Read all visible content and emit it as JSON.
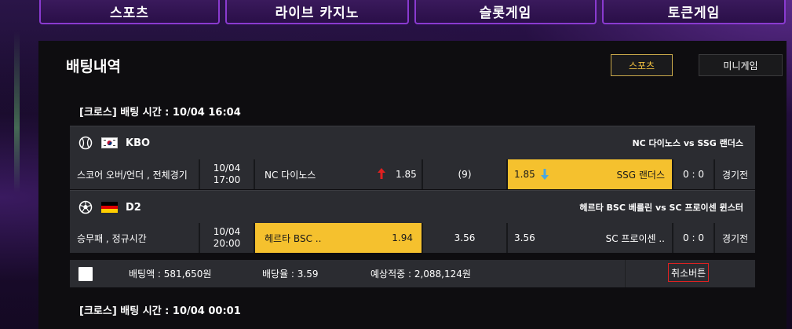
{
  "topnav": {
    "items": [
      "스포츠",
      "라이브 카지노",
      "슬롯게임",
      "토큰게임"
    ]
  },
  "panel": {
    "title": "배팅내역",
    "tabs": {
      "sports": "스포츠",
      "mini": "미니게임"
    }
  },
  "bets": [
    {
      "header": "[크로스] 배팅 시간 : 10/04 16:04",
      "matches": [
        {
          "sport_icon": "baseball-icon",
          "flag": "south-korea",
          "league": "KBO",
          "title": "NC 다이노스  vs  SSG 랜더스",
          "market": "스코어 오버/언더 , 전체경기",
          "date": "10/04",
          "time": "17:00",
          "home": "NC 다이노스",
          "home_odds": "1.85",
          "home_arrow": "up",
          "mid": "(9)",
          "away_odds": "1.85",
          "away_arrow": "down",
          "away": "SSG 랜더스",
          "selected": "away",
          "score": "0 : 0",
          "status": "경기전"
        },
        {
          "sport_icon": "soccer-ball-icon",
          "flag": "germany",
          "league": "D2",
          "title": "헤르타 BSC 베를린  vs  SC 프로이센 뮌스터",
          "market": "승무패 , 정규시간",
          "date": "10/04",
          "time": "20:00",
          "home": "헤르타 BSC ..",
          "home_odds": "1.94",
          "mid": "3.56",
          "away_odds": "3.56",
          "away": "SC 프로이센 ..",
          "selected": "home",
          "score": "0 : 0",
          "status": "경기전"
        }
      ],
      "summary": {
        "bet_amount": "배팅액 : 581,650원",
        "odds": "배당율 : 3.59",
        "expected": "예상적중 : 2,088,124원",
        "cancel": "취소버튼"
      }
    },
    {
      "header": "[크로스] 배팅 시간 : 10/04 00:01"
    }
  ],
  "colors": {
    "accent_yellow": "#f5c12e",
    "up_arrow": "#e02020",
    "down_arrow": "#4aa8e0",
    "cancel_border": "#dd2222",
    "nav_border": "#8a3ad0"
  }
}
